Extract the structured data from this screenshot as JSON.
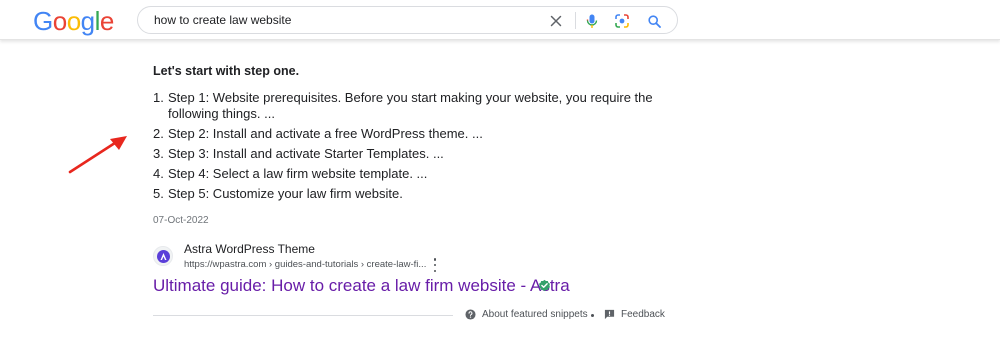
{
  "header": {
    "logo_letters": [
      {
        "ch": "G",
        "color": "#4285F4"
      },
      {
        "ch": "o",
        "color": "#EA4335"
      },
      {
        "ch": "o",
        "color": "#FBBC05"
      },
      {
        "ch": "g",
        "color": "#4285F4"
      },
      {
        "ch": "l",
        "color": "#34A853"
      },
      {
        "ch": "e",
        "color": "#EA4335"
      }
    ],
    "search_query": "how to create law website",
    "icons": [
      "close-icon",
      "mic-icon",
      "lens-icon",
      "search-icon"
    ]
  },
  "snippet": {
    "heading": "Let's start with step one.",
    "steps": [
      {
        "num": "1.",
        "text": "Step 1: Website prerequisites. Before you start making your website, you require the following things. ..."
      },
      {
        "num": "2.",
        "text": "Step 2: Install and activate a free WordPress theme. ..."
      },
      {
        "num": "3.",
        "text": "Step 3: Install and activate Starter Templates. ..."
      },
      {
        "num": "4.",
        "text": "Step 4: Select a law firm website template. ..."
      },
      {
        "num": "5.",
        "text": "Step 5: Customize your law firm website."
      }
    ],
    "date": "07-Oct-2022"
  },
  "source": {
    "site_name": "Astra WordPress Theme",
    "url": "https://wpastra.com › guides-and-tutorials › create-law-fi...",
    "favicon": "astra-logo-icon"
  },
  "result": {
    "title": "Ultimate guide: How to create a law firm website - Astra",
    "title_color": "#681da8",
    "verified_color": "#34a06b"
  },
  "footer": {
    "about": "About featured snippets",
    "feedback": "Feedback"
  },
  "annotation": {
    "arrow_color": "#e8271e"
  }
}
